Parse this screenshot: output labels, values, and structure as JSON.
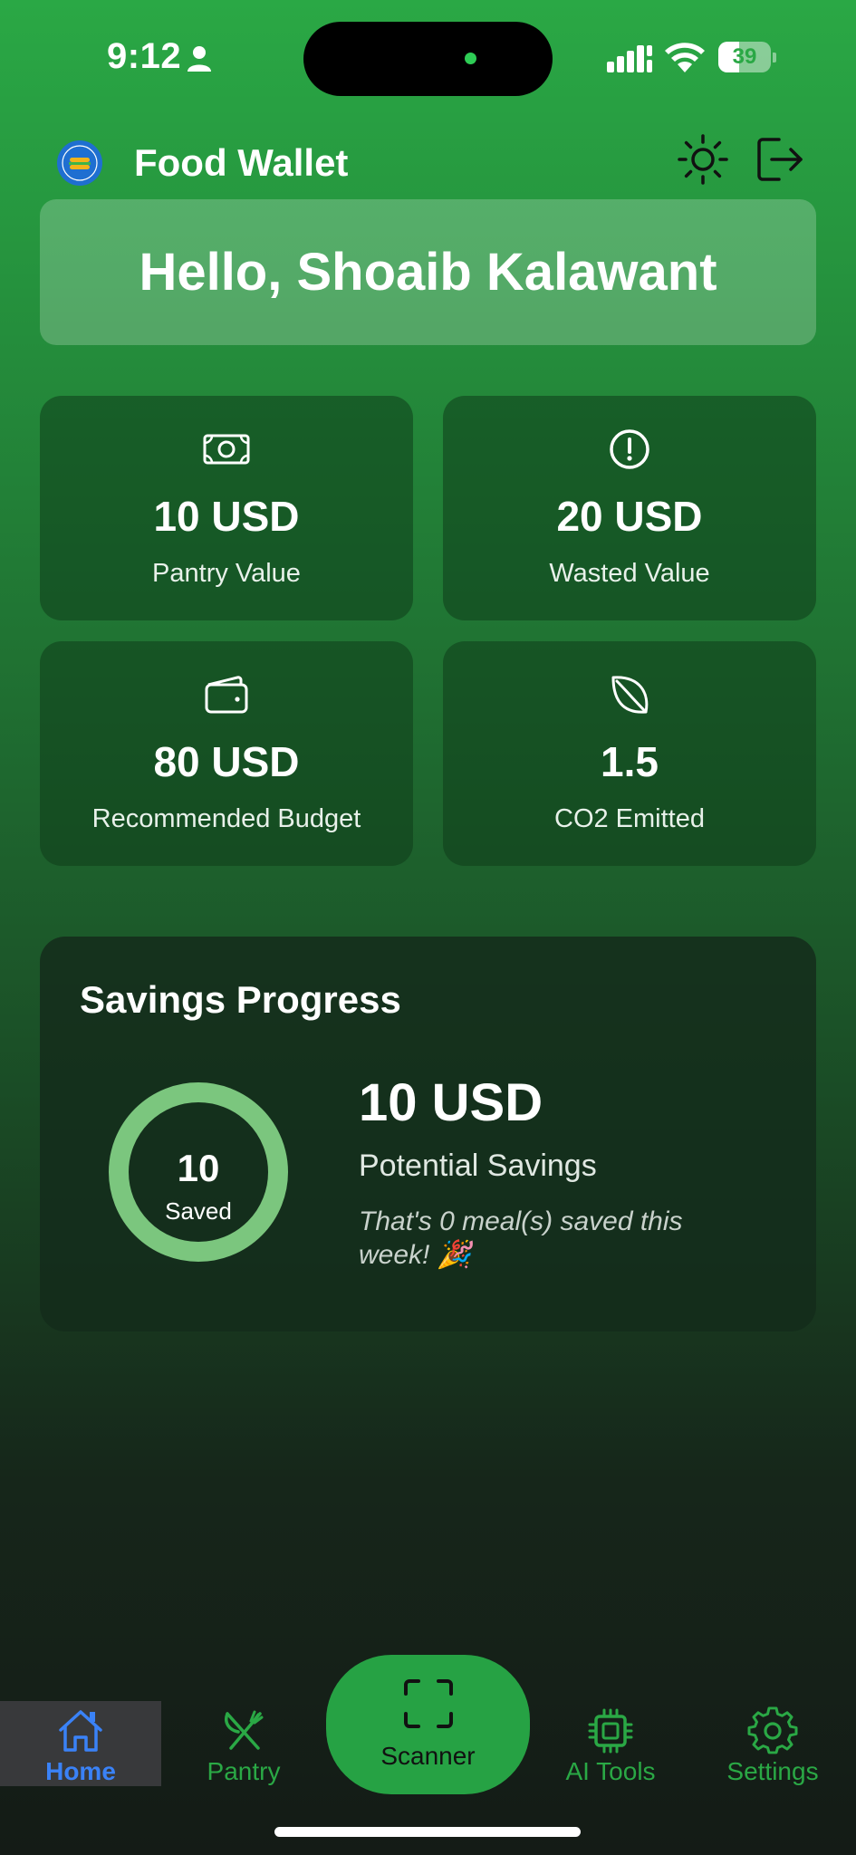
{
  "status_bar": {
    "time": "9:12",
    "battery_level": 39,
    "battery_text": "39"
  },
  "header": {
    "title": "Food Wallet",
    "logo_icon": "food-wallet-logo"
  },
  "greeting": "Hello, Shoaib Kalawant",
  "stats": {
    "pantry": {
      "value": "10 USD",
      "label": "Pantry Value",
      "icon": "money-icon"
    },
    "wasted": {
      "value": "20 USD",
      "label": "Wasted Value",
      "icon": "alert-circle-icon"
    },
    "budget": {
      "value": "80 USD",
      "label": "Recommended Budget",
      "icon": "wallet-icon"
    },
    "co2": {
      "value": "1.5",
      "label": "CO2 Emitted",
      "icon": "leaf-icon"
    }
  },
  "savings": {
    "title": "Savings Progress",
    "ring_value": "10",
    "ring_label": "Saved",
    "amount": "10 USD",
    "subtitle": "Potential Savings",
    "note": "That's 0 meal(s) saved this week! 🎉"
  },
  "nav": {
    "home": "Home",
    "pantry": "Pantry",
    "scanner": "Scanner",
    "ai_tools": "AI Tools",
    "settings": "Settings"
  },
  "colors": {
    "brand_green": "#2aa845",
    "active_nav": "#3a82f7",
    "ring": "#7bc67e"
  }
}
